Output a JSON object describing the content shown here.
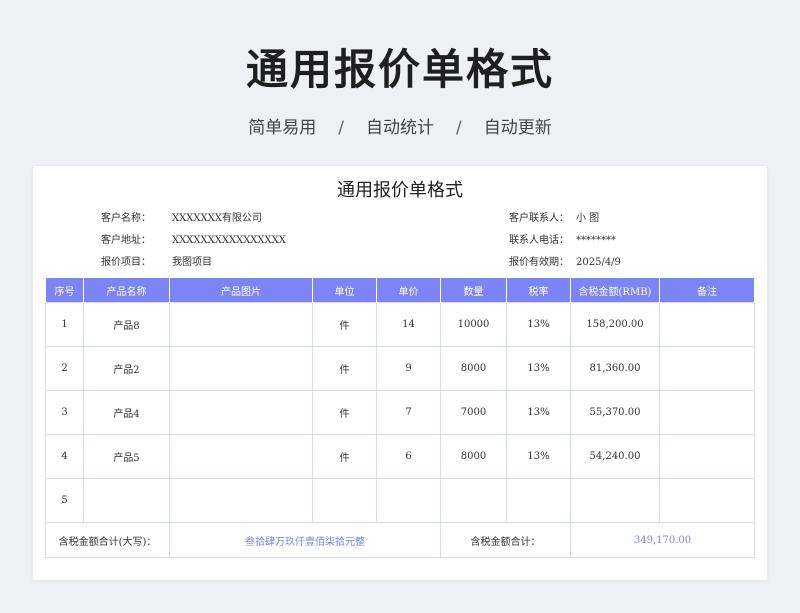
{
  "hero": {
    "title": "通用报价单格式",
    "subtitle": [
      "简单易用",
      "自动统计",
      "自动更新"
    ],
    "separator": "/"
  },
  "doc": {
    "title": "通用报价单格式",
    "info": {
      "customer_name_label": "客户名称：",
      "customer_name": "XXXXXXX有限公司",
      "customer_address_label": "客户地址：",
      "customer_address": "XXXXXXXXXXXXXXXX",
      "project_label": "报价项目：",
      "project": "我图项目",
      "contact_label": "客户联系人：",
      "contact": "小  图",
      "phone_label": "联系人电话：",
      "phone": "********",
      "validity_label": "报价有效期：",
      "validity": "2025/4/9"
    },
    "table": {
      "headers": [
        "序号",
        "产品名称",
        "产品图片",
        "单位",
        "单价",
        "数量",
        "税率",
        "含税金额(RMB)",
        "备注"
      ],
      "rows": [
        {
          "no": "1",
          "name": "产品8",
          "image": "",
          "unit": "件",
          "price": "14",
          "qty": "10000",
          "tax": "13%",
          "amount": "158,200.00",
          "note": ""
        },
        {
          "no": "2",
          "name": "产品2",
          "image": "",
          "unit": "件",
          "price": "9",
          "qty": "8000",
          "tax": "13%",
          "amount": "81,360.00",
          "note": ""
        },
        {
          "no": "3",
          "name": "产品4",
          "image": "",
          "unit": "件",
          "price": "7",
          "qty": "7000",
          "tax": "13%",
          "amount": "55,370.00",
          "note": ""
        },
        {
          "no": "4",
          "name": "产品5",
          "image": "",
          "unit": "件",
          "price": "6",
          "qty": "8000",
          "tax": "13%",
          "amount": "54,240.00",
          "note": ""
        },
        {
          "no": "5",
          "name": "",
          "image": "",
          "unit": "",
          "price": "",
          "qty": "",
          "tax": "",
          "amount": "",
          "note": ""
        }
      ],
      "total_words_label": "含税金额合计(大写)：",
      "total_words": "叁拾肆万玖仟壹佰柒拾元整",
      "total_label": "含税金额合计：",
      "total_value": "349,170.00"
    },
    "colors": {
      "header_bg": "#7b85f5",
      "accent_text": "#7b85e0",
      "grid_line": "#d6ddf2"
    }
  }
}
